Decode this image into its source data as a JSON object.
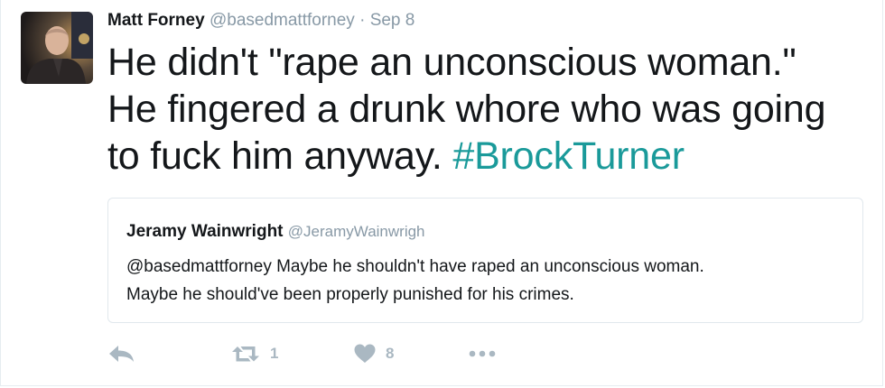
{
  "tweet": {
    "author_name": "Matt Forney",
    "author_handle": "@basedmattforney",
    "separator": "·",
    "date": "Sep 8",
    "text_lines": [
      "He didn't \"rape an unconscious woman.\"",
      "He fingered a drunk whore who was going",
      "to fuck him anyway. "
    ],
    "hashtag": "#BrockTurner"
  },
  "quoted_tweet": {
    "author_name": "Jeramy Wainwright",
    "author_handle": "@JeramyWainwrigh",
    "text_lines": [
      "@basedmattforney Maybe he shouldn't have raped an unconscious woman.",
      "Maybe he should've been properly punished for his crimes."
    ]
  },
  "actions": {
    "reply_icon": "reply-icon",
    "retweet_icon": "retweet-icon",
    "retweet_count": "1",
    "like_icon": "heart-icon",
    "like_count": "8",
    "more_icon": "more-icon"
  },
  "colors": {
    "hashtag": "#1a9a9a",
    "muted": "#8899a6",
    "action_icons": "#aab8c2",
    "border": "#e1e8ed"
  }
}
